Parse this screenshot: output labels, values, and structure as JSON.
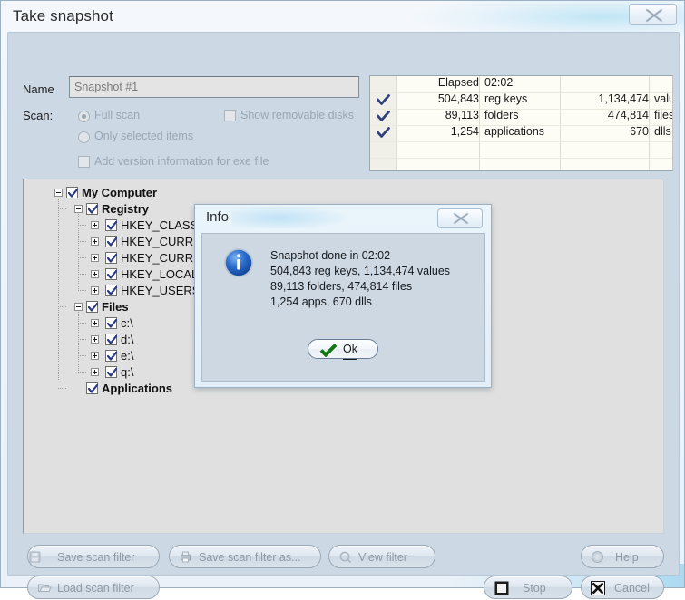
{
  "window": {
    "title": "Take snapshot",
    "close_icon": "close-x-icon"
  },
  "form": {
    "name_label": "Name",
    "name_value": "Snapshot #1",
    "scan_label": "Scan:",
    "radio_full": "Full scan",
    "radio_selected": "Only selected items",
    "check_removable": "Show removable disks",
    "check_version": "Add version information for exe file"
  },
  "stats": {
    "rows": [
      {
        "check": "",
        "num": "",
        "label": "Elapsed",
        "num2": "02:02",
        "label2": "",
        "elapsed": true
      },
      {
        "check": "check-icon",
        "num": "504,843",
        "label": "reg keys",
        "num2": "1,134,474",
        "label2": "values"
      },
      {
        "check": "check-icon",
        "num": "89,113",
        "label": "folders",
        "num2": "474,814",
        "label2": "files"
      },
      {
        "check": "check-icon",
        "num": "1,254",
        "label": "applications",
        "num2": "670",
        "label2": "dlls"
      }
    ],
    "elapsed_label": "Elapsed",
    "elapsed_value": "02:02"
  },
  "tree": {
    "nodes": [
      {
        "label": "My Computer",
        "depth": 0,
        "bold": true,
        "expander": "minus",
        "checked": true
      },
      {
        "label": "Registry",
        "depth": 1,
        "bold": true,
        "expander": "minus",
        "checked": true
      },
      {
        "label": "HKEY_CLASSES_ROOT",
        "depth": 2,
        "bold": false,
        "expander": "plus",
        "checked": true
      },
      {
        "label": "HKEY_CURRENT_CONFIG",
        "depth": 2,
        "bold": false,
        "expander": "plus",
        "checked": true
      },
      {
        "label": "HKEY_CURRENT_USER",
        "depth": 2,
        "bold": false,
        "expander": "plus",
        "checked": true
      },
      {
        "label": "HKEY_LOCAL_MACHINE",
        "depth": 2,
        "bold": false,
        "expander": "plus",
        "checked": true
      },
      {
        "label": "HKEY_USERS",
        "depth": 2,
        "bold": false,
        "expander": "plus",
        "checked": true
      },
      {
        "label": "Files",
        "depth": 1,
        "bold": true,
        "expander": "minus",
        "checked": true
      },
      {
        "label": "c:\\",
        "depth": 2,
        "bold": false,
        "expander": "plus",
        "checked": true
      },
      {
        "label": "d:\\",
        "depth": 2,
        "bold": false,
        "expander": "plus",
        "checked": true
      },
      {
        "label": "e:\\",
        "depth": 2,
        "bold": false,
        "expander": "plus",
        "checked": true
      },
      {
        "label": "q:\\",
        "depth": 2,
        "bold": false,
        "expander": "plus",
        "checked": true
      },
      {
        "label": "Applications",
        "depth": 1,
        "bold": true,
        "expander": "none",
        "checked": true
      }
    ]
  },
  "buttons": {
    "save_scan_filter": "Save scan filter",
    "save_scan_filter_as": "Save scan filter as...",
    "view_filter": "View filter",
    "load_scan_filter": "Load scan filter",
    "help": "Help",
    "stop": "Stop",
    "cancel": "Cancel"
  },
  "info_dialog": {
    "title": "Info",
    "icon": "info-circle-icon",
    "message": "Snapshot done in 02:02\n504,843 reg keys, 1,134,474 values\n89,113 folders, 474,814 files\n1,254 apps, 670 dlls",
    "ok_label": "Ok",
    "close_icon": "close-x-icon"
  },
  "colors": {
    "window_bg": "#ccd9e5",
    "titlebar": "#eaf1f8",
    "tree_bg": "#e0e0e0",
    "stats_bg": "#fdfcf5",
    "check_blue": "#2f3f84",
    "info_blue": "#1f63c8",
    "ok_green": "#1a7a1a",
    "disabled_text": "#9aa7b3"
  }
}
